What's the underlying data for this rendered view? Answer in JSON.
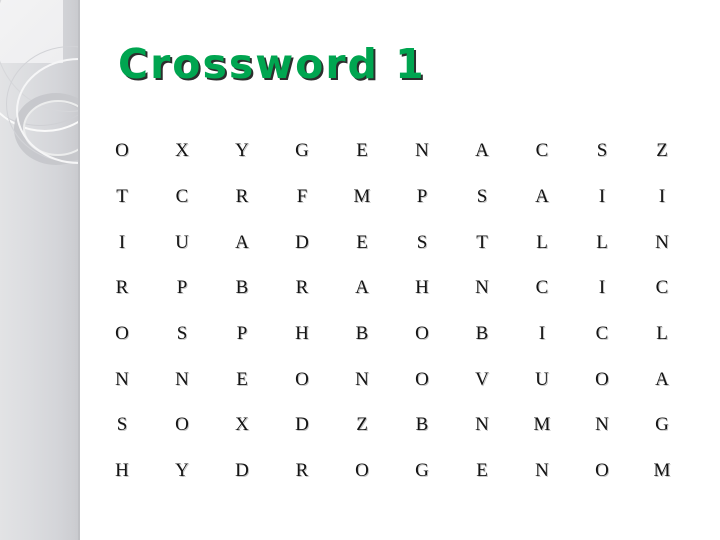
{
  "slide": {
    "background_color": "#ffffff",
    "title": "Crossword 1",
    "title_color": "#00a550",
    "title_shadow_color": "#2d2d2d"
  },
  "sidebar": {
    "name": "decorative-sidebar",
    "background_colors": [
      "#e2e3e5",
      "#c8c9cd"
    ],
    "ring_color": "#c6c7cb"
  },
  "grid": {
    "columns": 10,
    "rows_count": 8,
    "letter_color": "#141414",
    "rows": [
      [
        "O",
        "X",
        "Y",
        "G",
        "E",
        "N",
        "A",
        "C",
        "S",
        "Z"
      ],
      [
        "T",
        "C",
        "R",
        "F",
        "M",
        "P",
        "S",
        "A",
        "I",
        "I"
      ],
      [
        "I",
        "U",
        "A",
        "D",
        "E",
        "S",
        "T",
        "L",
        "L",
        "N"
      ],
      [
        "R",
        "P",
        "B",
        "R",
        "A",
        "H",
        "N",
        "C",
        "I",
        "C"
      ],
      [
        "O",
        "S",
        "P",
        "H",
        "B",
        "O",
        "B",
        "I",
        "C",
        "L"
      ],
      [
        "N",
        "N",
        "E",
        "O",
        "N",
        "O",
        "V",
        "U",
        "O",
        "A"
      ],
      [
        "S",
        "O",
        "X",
        "D",
        "Z",
        "B",
        "N",
        "M",
        "N",
        "G"
      ],
      [
        "H",
        "Y",
        "D",
        "R",
        "O",
        "G",
        "E",
        "N",
        "O",
        "M"
      ]
    ]
  }
}
